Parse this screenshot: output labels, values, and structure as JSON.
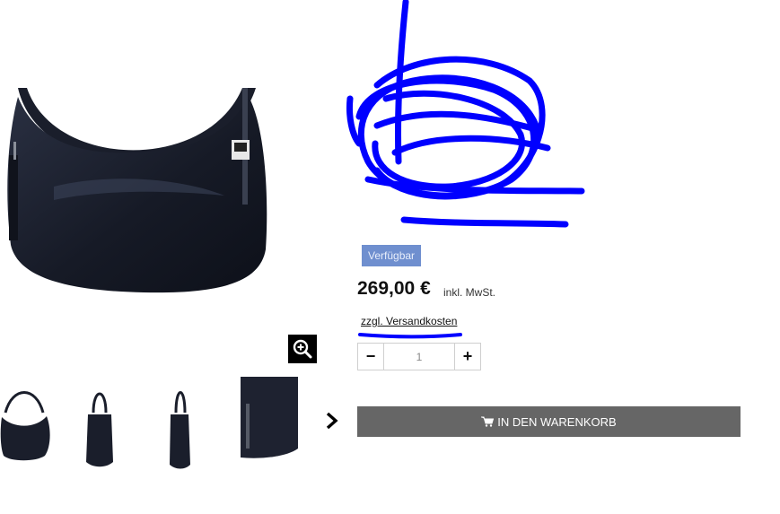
{
  "product": {
    "availability": "Verfügbar",
    "price": "269,00 €",
    "tax_note": "inkl. MwSt.",
    "shipping_link": "zzgl. Versandkosten"
  },
  "quantity": {
    "value": "1",
    "decrement_icon": "minus-icon",
    "increment_icon": "plus-icon"
  },
  "cart": {
    "label": "IN DEN WARENKORB",
    "icon": "cart-icon"
  },
  "gallery": {
    "zoom_icon": "magnifier-plus-icon",
    "next_icon": "chevron-right-icon",
    "thumbnails": [
      "front",
      "side",
      "side-slim",
      "detail"
    ]
  },
  "colors": {
    "badge_bg": "#6f8fcf",
    "cart_bg": "#666666",
    "scribble": "#0000ff",
    "bag": "#1a1e2b"
  }
}
